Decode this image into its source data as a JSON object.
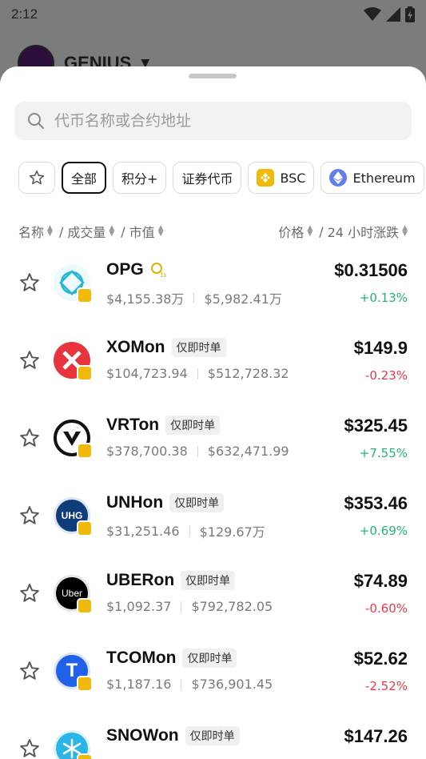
{
  "status_bar": {
    "time": "2:12"
  },
  "background": {
    "title": "GENIUS"
  },
  "search": {
    "placeholder": "代币名称或合约地址"
  },
  "filters": [
    {
      "label": "全部",
      "active": true
    },
    {
      "label": "积分+"
    },
    {
      "label": "证券代币"
    },
    {
      "label": "BSC"
    },
    {
      "label": "Ethereum"
    }
  ],
  "columns": {
    "name": "名称",
    "volume": "成交量",
    "market_cap": "市值",
    "price": "价格",
    "change": "24 小时涨跌"
  },
  "colors": {
    "up": "#22b573",
    "down": "#e8384f",
    "bsc": "#f0b90b",
    "eth": "#627eea"
  },
  "tokens": [
    {
      "name": "OPG",
      "tag": "",
      "volume": "$4,155.38万",
      "market_cap": "$5,982.41万",
      "price": "$0.31506",
      "change": "+0.13%",
      "direction": "up",
      "logo": "opg-logo"
    },
    {
      "name": "XOMon",
      "tag": "仅即时单",
      "volume": "$104,723.94",
      "market_cap": "$512,728.32",
      "price": "$149.9",
      "change": "-0.23%",
      "direction": "down",
      "logo": "xom-logo"
    },
    {
      "name": "VRTon",
      "tag": "仅即时单",
      "volume": "$378,700.38",
      "market_cap": "$632,471.99",
      "price": "$325.45",
      "change": "+7.55%",
      "direction": "up",
      "logo": "vrt-logo"
    },
    {
      "name": "UNHon",
      "tag": "仅即时单",
      "volume": "$31,251.46",
      "market_cap": "$129.67万",
      "price": "$353.46",
      "change": "+0.69%",
      "direction": "up",
      "logo": "unh-logo",
      "logo_text": "UHG"
    },
    {
      "name": "UBERon",
      "tag": "仅即时单",
      "volume": "$1,092.37",
      "market_cap": "$792,782.05",
      "price": "$74.89",
      "change": "-0.60%",
      "direction": "down",
      "logo": "uber-logo",
      "logo_text": "Uber"
    },
    {
      "name": "TCOMon",
      "tag": "仅即时单",
      "volume": "$1,187.16",
      "market_cap": "$736,901.45",
      "price": "$52.62",
      "change": "-2.52%",
      "direction": "down",
      "logo": "tcom-logo",
      "logo_text": "T"
    },
    {
      "name": "SNOWon",
      "tag": "仅即时单",
      "volume": "",
      "market_cap": "",
      "price": "$147.26",
      "change": "",
      "direction": "up",
      "logo": "snow-logo"
    }
  ]
}
